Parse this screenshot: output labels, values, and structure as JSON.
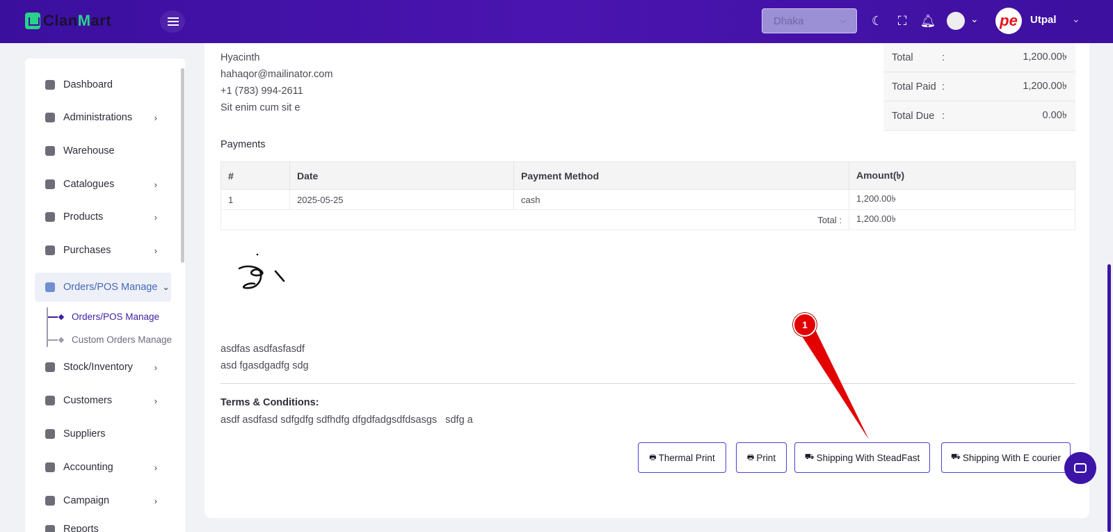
{
  "header": {
    "brand_prefix": "Clan",
    "brand_accent": "M",
    "brand_suffix": "art",
    "location": "Dhaka",
    "user_name": "Utpal",
    "avatar_text": "pe",
    "accent_color": "#3b0f9e"
  },
  "sidebar": {
    "items": [
      {
        "label": "Dashboard",
        "icon": "monitor-icon"
      },
      {
        "label": "Administrations",
        "icon": "user-gear-icon"
      },
      {
        "label": "Warehouse",
        "icon": "warehouse-icon"
      },
      {
        "label": "Catalogues",
        "icon": "catalogue-icon"
      },
      {
        "label": "Products",
        "icon": "cart-icon"
      },
      {
        "label": "Purchases",
        "icon": "bag-icon"
      },
      {
        "label": "Orders/POS Manage",
        "icon": "clipboard-icon"
      },
      {
        "label": "Stock/Inventory",
        "icon": "box-icon"
      },
      {
        "label": "Customers",
        "icon": "users-icon"
      },
      {
        "label": "Suppliers",
        "icon": "supplier-icon"
      },
      {
        "label": "Accounting",
        "icon": "ledger-icon"
      },
      {
        "label": "Campaign",
        "icon": "campaign-icon"
      },
      {
        "label": "Reports",
        "icon": "report-icon"
      }
    ],
    "sub_items": [
      {
        "label": "Orders/POS Manage"
      },
      {
        "label": "Custom Orders Manage"
      }
    ]
  },
  "customer": {
    "name": "Hyacinth",
    "email": "hahaqor@mailinator.com",
    "phone": "+1 (783) 994-2611",
    "address": "Sit enim cum sit e"
  },
  "summary": [
    {
      "label": "Total",
      "sep": ":",
      "value": "1,200.00৳"
    },
    {
      "label": "Total Paid",
      "sep": ":",
      "value": "1,200.00৳"
    },
    {
      "label": "Total Due",
      "sep": ":",
      "value": "0.00৳"
    }
  ],
  "payments": {
    "title": "Payments",
    "headers": [
      "#",
      "Date",
      "Payment Method",
      "Amount(৳)"
    ],
    "rows": [
      {
        "no": "1",
        "date": "2025-05-25",
        "method": "cash",
        "amount": "1,200.00৳"
      }
    ],
    "total_label": "Total :",
    "total_value": "1,200.00৳"
  },
  "notes": [
    "asdfas asdfasfasdf",
    "asd fgasdgadfg sdg"
  ],
  "terms": {
    "title": "Terms & Conditions:",
    "text": "asdf asdfasd sdfgdfg sdfhdfg dfgdfadgsdfdsasgs   sdfg a"
  },
  "buttons": {
    "thermal_print": "Thermal Print",
    "print": "Print",
    "steadfast": "Shipping With SteadFast",
    "ecourier": "Shipping With E courier"
  },
  "annotation": {
    "badge": "1",
    "color": "#e30000"
  }
}
